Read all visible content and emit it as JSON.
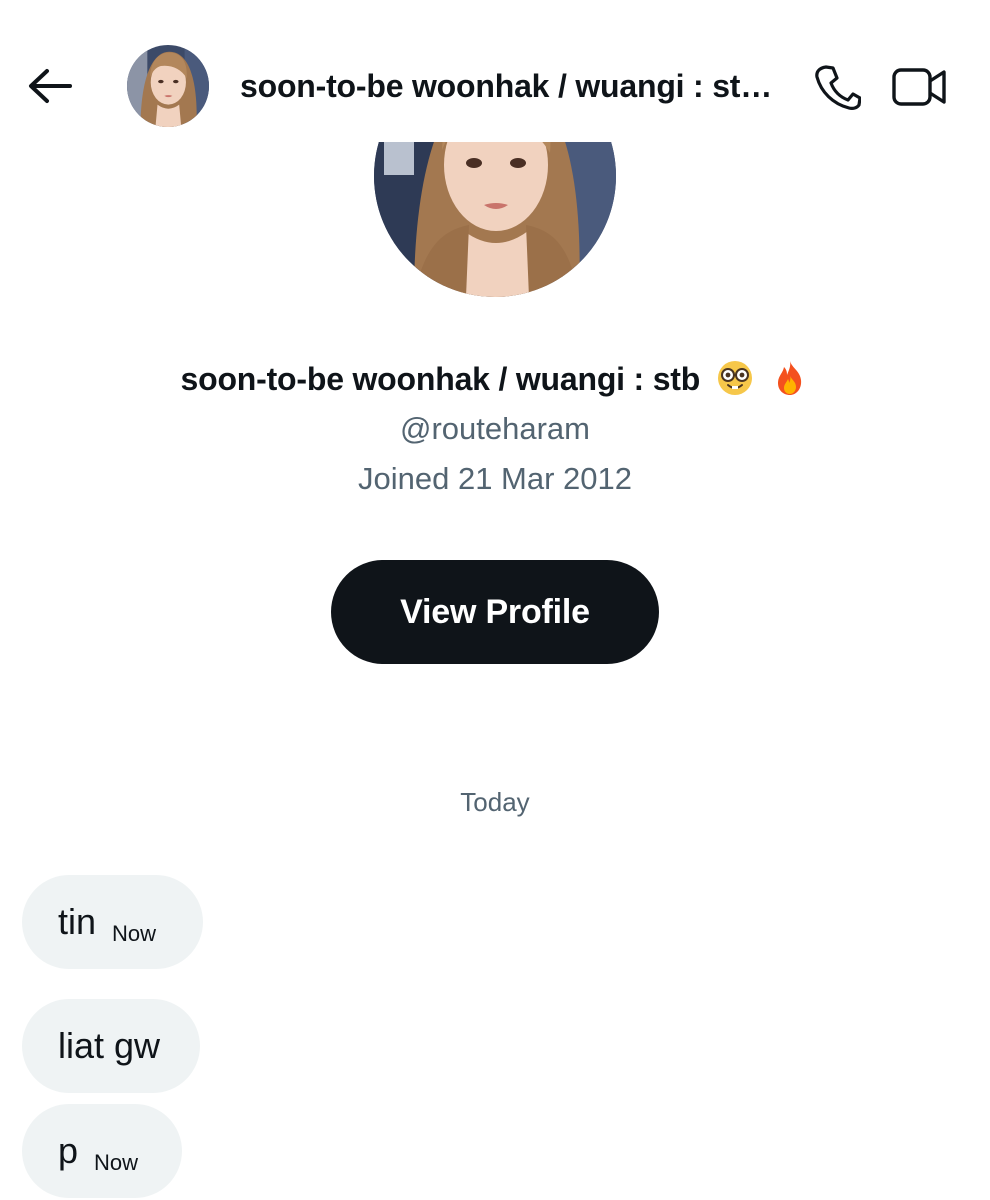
{
  "header": {
    "title": "soon-to-be woonhak / wuangi : stb 🤓 🔥",
    "back_icon": "arrow-left-icon",
    "call_icon": "phone-icon",
    "video_icon": "video-camera-icon"
  },
  "profile": {
    "name": "soon-to-be woonhak / wuangi : stb",
    "emojis": [
      "nerd-face-emoji",
      "fire-emoji"
    ],
    "handle": "@routeharam",
    "joined": "Joined 21 Mar 2012",
    "view_profile_label": "View Profile"
  },
  "conversation": {
    "date_divider": "Today",
    "messages": [
      {
        "text": "tin",
        "time": "Now"
      },
      {
        "text": "liat gw",
        "time": ""
      },
      {
        "text": "p",
        "time": "Now"
      }
    ]
  },
  "colors": {
    "primary_text": "#0f1419",
    "secondary_text": "#536471",
    "bubble_bg": "#eff3f4",
    "button_bg": "#0f1419"
  }
}
